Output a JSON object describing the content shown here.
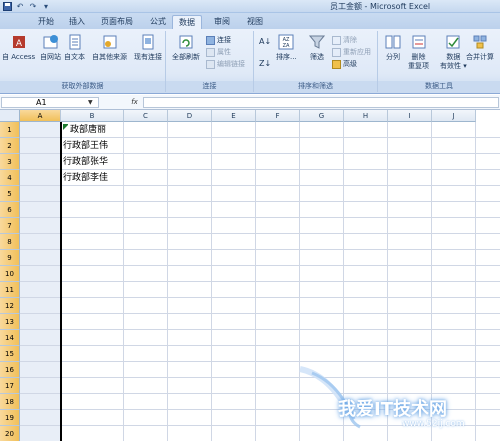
{
  "window": {
    "title": "员工金额 - Microsoft Excel"
  },
  "tabs": [
    {
      "label": "开始",
      "active": false
    },
    {
      "label": "插入",
      "active": false
    },
    {
      "label": "页面布局",
      "active": false
    },
    {
      "label": "公式",
      "active": false
    },
    {
      "label": "数据",
      "active": true
    },
    {
      "label": "审阅",
      "active": false
    },
    {
      "label": "视图",
      "active": false
    }
  ],
  "ribbon": {
    "groups": {
      "external": "获取外部数据",
      "connections": "连接",
      "sort_filter": "排序和筛选",
      "data_tools": "数据工具"
    },
    "buttons": {
      "access": "自 Access",
      "web": "自网站",
      "text": "自文本",
      "other": "自其他来源",
      "existing": "现有连接",
      "refresh_all": "全部刷新",
      "connections": "连接",
      "properties": "属性",
      "edit_links": "编辑链接",
      "sort": "排序...",
      "filter": "筛选",
      "clear": "清除",
      "reapply": "重新应用",
      "advanced": "高级",
      "text_to_columns": "分列",
      "remove_dup_1": "删除",
      "remove_dup_2": "重复项",
      "validation_1": "数据",
      "validation_2": "有效性",
      "consolidate": "合并计算"
    }
  },
  "formula_bar": {
    "name_box": "A1",
    "fx": "fx",
    "formula": ""
  },
  "colors": {
    "selected_header": "#f1c05a",
    "tab_active": "#eaf1fb",
    "ribbon": "#dfe9f7"
  },
  "grid": {
    "columns": [
      "A",
      "B",
      "C",
      "D",
      "E",
      "F",
      "G",
      "H",
      "I",
      "J"
    ],
    "rows": [
      "1",
      "2",
      "3",
      "4",
      "5",
      "6",
      "7",
      "8",
      "9",
      "10",
      "11",
      "12",
      "13",
      "14",
      "15",
      "16",
      "17",
      "18",
      "19",
      "20"
    ],
    "cells": [
      {
        "ref": "B1",
        "value": "政部唐丽"
      },
      {
        "ref": "B2",
        "value": "行政部王伟"
      },
      {
        "ref": "B3",
        "value": "行政部张华"
      },
      {
        "ref": "B4",
        "value": "行政部李佳"
      }
    ]
  },
  "watermark": {
    "text": "我爱IT技术网",
    "url": "www.52ij.com"
  }
}
